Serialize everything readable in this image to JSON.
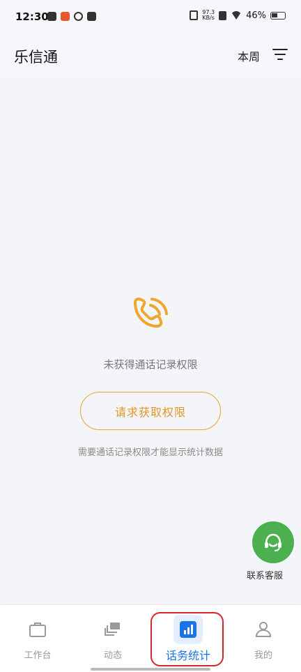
{
  "status_bar": {
    "time": "12:30",
    "net_speed_value": "97.3",
    "net_speed_unit": "KB/s",
    "battery": "46%"
  },
  "header": {
    "title": "乐信通",
    "period_button": "本周"
  },
  "empty_state": {
    "title": "未获得通话记录权限",
    "request_button": "请求获取权限",
    "hint": "需要通话记录权限才能显示统计数据",
    "accent_color": "#e5a431"
  },
  "customer_service": {
    "label": "联系客服"
  },
  "bottom_nav": {
    "items": [
      {
        "label": "工作台",
        "icon": "briefcase-icon"
      },
      {
        "label": "动态",
        "icon": "stack-icon"
      },
      {
        "label": "话务统计",
        "icon": "bar-chart-icon",
        "active": true
      },
      {
        "label": "我的",
        "icon": "person-icon"
      }
    ],
    "active_color": "#1a73e8"
  }
}
